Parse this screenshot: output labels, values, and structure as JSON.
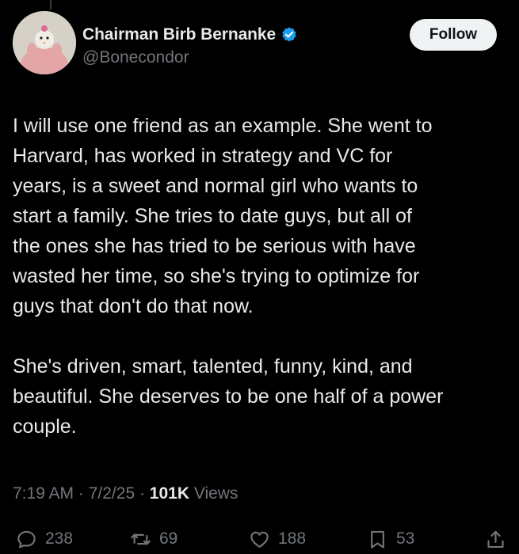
{
  "author": {
    "display_name": "Chairman Birb Bernanke",
    "handle": "@Bonecondor",
    "verified": true,
    "verified_color": "#1d9bf0"
  },
  "follow_label": "Follow",
  "tweet": {
    "paragraphs": [
      "I will use one friend as an example. She went to\nHarvard, has worked in strategy and VC for\nyears, is a sweet and normal girl who wants to\nstart a family. She tries to date guys, but all of\nthe ones she has tried to be serious with have\nwasted her time, so she's trying to optimize for\nguys that don't do that now.",
      "She's driven, smart, talented, funny, kind, and\nbeautiful. She deserves to be one half of a power\ncouple."
    ]
  },
  "meta": {
    "time": "7:19 AM",
    "separator": " · ",
    "date": "7/2/25",
    "views_count": "101K",
    "views_label": " Views"
  },
  "actions": {
    "replies": "238",
    "reposts": "69",
    "likes": "188",
    "bookmarks": "53"
  },
  "icons": [
    "reply-icon",
    "repost-icon",
    "like-icon",
    "bookmark-icon",
    "share-icon",
    "verified-badge-icon"
  ],
  "colors": {
    "background": "#000000",
    "text_primary": "#e7e9ea",
    "text_secondary": "#71767b",
    "follow_button_bg": "#eff3f4"
  }
}
